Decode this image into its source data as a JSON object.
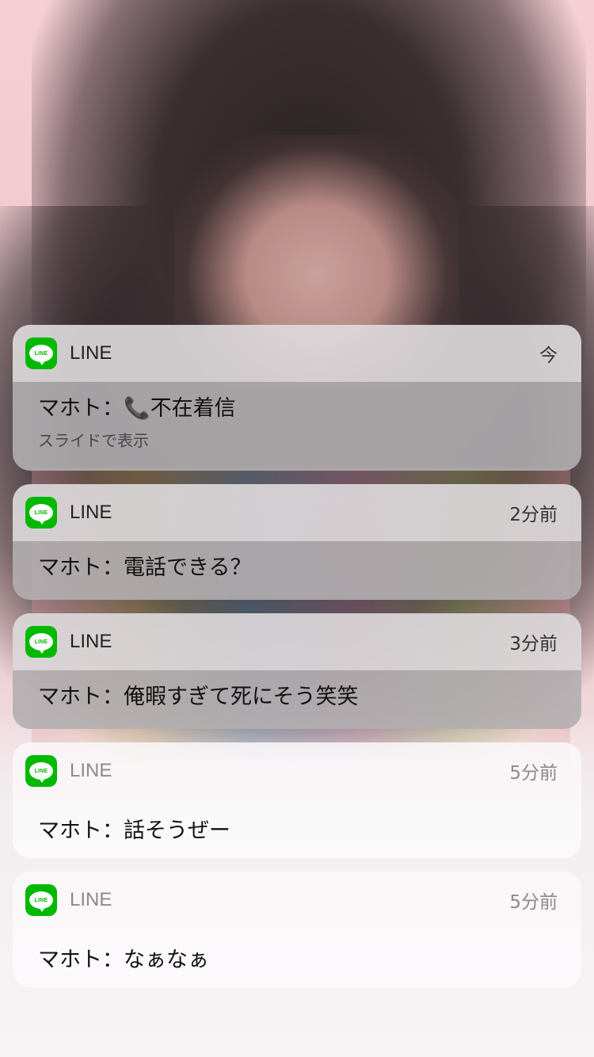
{
  "notifications": [
    {
      "app": "LINE",
      "icon_label": "LINE",
      "time": "今",
      "message": "マホト：📞不在着信",
      "sub": "スライドで表示"
    },
    {
      "app": "LINE",
      "icon_label": "LINE",
      "time": "2分前",
      "message": "マホト：電話できる？"
    },
    {
      "app": "LINE",
      "icon_label": "LINE",
      "time": "3分前",
      "message": "マホト：俺暇すぎて死にそう笑笑"
    },
    {
      "app": "LINE",
      "icon_label": "LINE",
      "time": "5分前",
      "message": "マホト：話そうぜー"
    },
    {
      "app": "LINE",
      "icon_label": "LINE",
      "time": "5分前",
      "message": "マホト：なぁなぁ"
    }
  ],
  "colors": {
    "line_green": "#00b900"
  }
}
